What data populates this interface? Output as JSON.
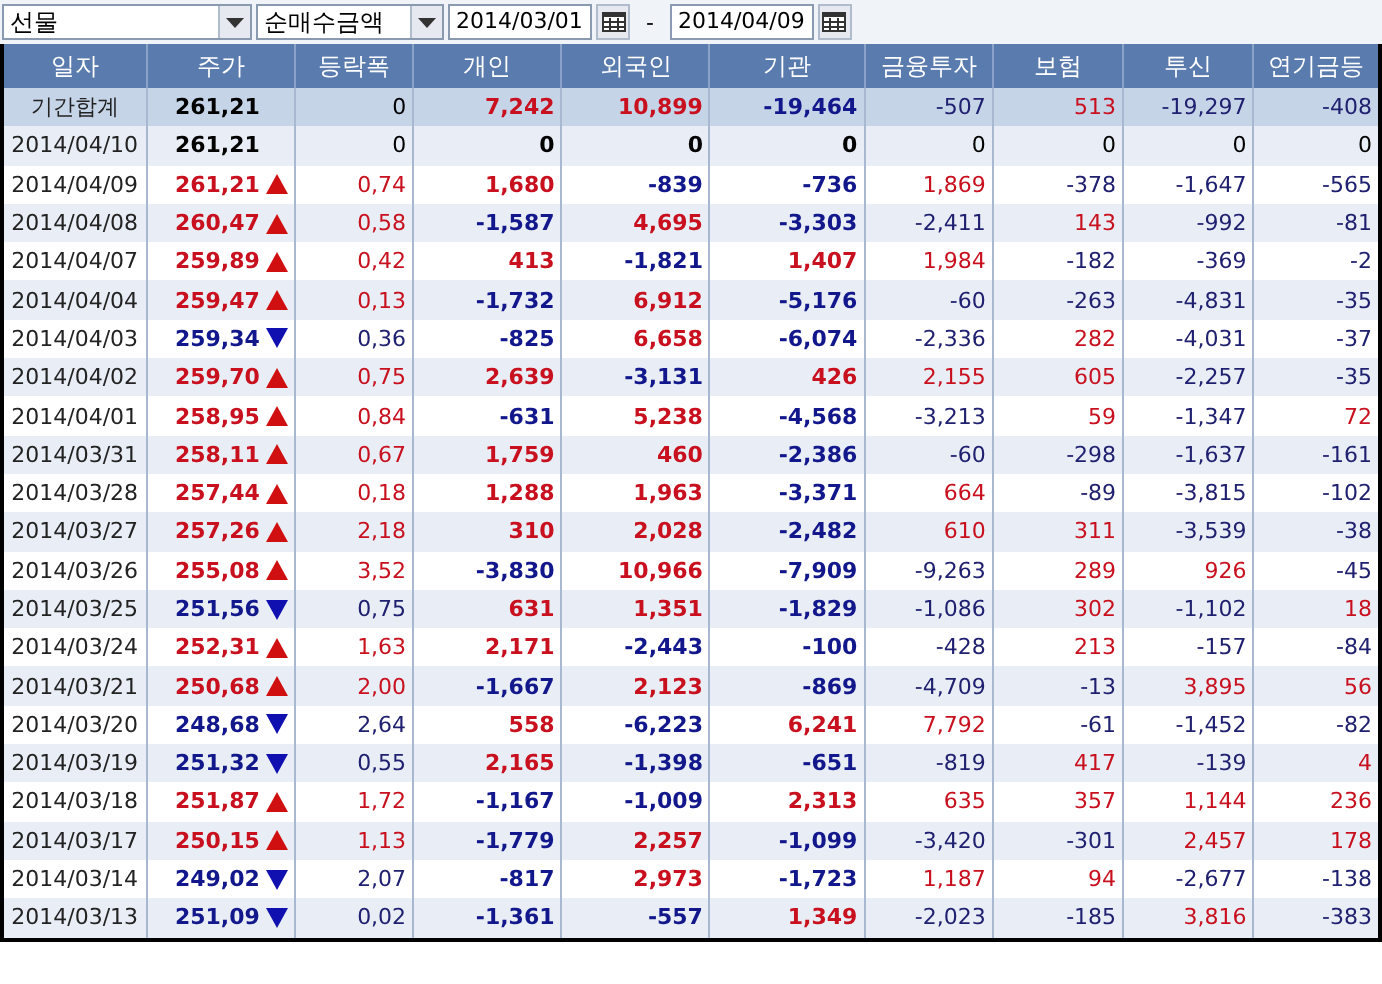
{
  "toolbar": {
    "market": "선물",
    "measure": "순매수금액",
    "date_from": "2014/03/01",
    "separator": "-",
    "date_to": "2014/04/09"
  },
  "columns": [
    "일자",
    "주가",
    "등락폭",
    "개인",
    "외국인",
    "기관",
    "금융투자",
    "보험",
    "투신",
    "연기금등"
  ],
  "rows": [
    {
      "kind": "total",
      "date": "기간합계",
      "price": "261,21",
      "up": false,
      "down": false,
      "change": "0",
      "values": [
        "7,242",
        "10,899",
        "-19,464",
        "-507",
        "513",
        "-19,297",
        "-408"
      ]
    },
    {
      "kind": "day",
      "date": "2014/04/10",
      "price": "261,21",
      "up": false,
      "down": false,
      "change": "0",
      "values": [
        "0",
        "0",
        "0",
        "0",
        "0",
        "0",
        "0"
      ]
    },
    {
      "kind": "day",
      "date": "2014/04/09",
      "price": "261,21",
      "up": true,
      "down": false,
      "change": "0,74",
      "values": [
        "1,680",
        "-839",
        "-736",
        "1,869",
        "-378",
        "-1,647",
        "-565"
      ]
    },
    {
      "kind": "day",
      "date": "2014/04/08",
      "price": "260,47",
      "up": true,
      "down": false,
      "change": "0,58",
      "values": [
        "-1,587",
        "4,695",
        "-3,303",
        "-2,411",
        "143",
        "-992",
        "-81"
      ]
    },
    {
      "kind": "day",
      "date": "2014/04/07",
      "price": "259,89",
      "up": true,
      "down": false,
      "change": "0,42",
      "values": [
        "413",
        "-1,821",
        "1,407",
        "1,984",
        "-182",
        "-369",
        "-2"
      ]
    },
    {
      "kind": "day",
      "date": "2014/04/04",
      "price": "259,47",
      "up": true,
      "down": false,
      "change": "0,13",
      "values": [
        "-1,732",
        "6,912",
        "-5,176",
        "-60",
        "-263",
        "-4,831",
        "-35"
      ]
    },
    {
      "kind": "day",
      "date": "2014/04/03",
      "price": "259,34",
      "up": false,
      "down": true,
      "change": "0,36",
      "values": [
        "-825",
        "6,658",
        "-6,074",
        "-2,336",
        "282",
        "-4,031",
        "-37"
      ]
    },
    {
      "kind": "day",
      "date": "2014/04/02",
      "price": "259,70",
      "up": true,
      "down": false,
      "change": "0,75",
      "values": [
        "2,639",
        "-3,131",
        "426",
        "2,155",
        "605",
        "-2,257",
        "-35"
      ]
    },
    {
      "kind": "day",
      "date": "2014/04/01",
      "price": "258,95",
      "up": true,
      "down": false,
      "change": "0,84",
      "values": [
        "-631",
        "5,238",
        "-4,568",
        "-3,213",
        "59",
        "-1,347",
        "72"
      ]
    },
    {
      "kind": "day",
      "date": "2014/03/31",
      "price": "258,11",
      "up": true,
      "down": false,
      "change": "0,67",
      "values": [
        "1,759",
        "460",
        "-2,386",
        "-60",
        "-298",
        "-1,637",
        "-161"
      ]
    },
    {
      "kind": "day",
      "date": "2014/03/28",
      "price": "257,44",
      "up": true,
      "down": false,
      "change": "0,18",
      "values": [
        "1,288",
        "1,963",
        "-3,371",
        "664",
        "-89",
        "-3,815",
        "-102"
      ]
    },
    {
      "kind": "day",
      "date": "2014/03/27",
      "price": "257,26",
      "up": true,
      "down": false,
      "change": "2,18",
      "values": [
        "310",
        "2,028",
        "-2,482",
        "610",
        "311",
        "-3,539",
        "-38"
      ]
    },
    {
      "kind": "day",
      "date": "2014/03/26",
      "price": "255,08",
      "up": true,
      "down": false,
      "change": "3,52",
      "values": [
        "-3,830",
        "10,966",
        "-7,909",
        "-9,263",
        "289",
        "926",
        "-45"
      ]
    },
    {
      "kind": "day",
      "date": "2014/03/25",
      "price": "251,56",
      "up": false,
      "down": true,
      "change": "0,75",
      "values": [
        "631",
        "1,351",
        "-1,829",
        "-1,086",
        "302",
        "-1,102",
        "18"
      ]
    },
    {
      "kind": "day",
      "date": "2014/03/24",
      "price": "252,31",
      "up": true,
      "down": false,
      "change": "1,63",
      "values": [
        "2,171",
        "-2,443",
        "-100",
        "-428",
        "213",
        "-157",
        "-84"
      ]
    },
    {
      "kind": "day",
      "date": "2014/03/21",
      "price": "250,68",
      "up": true,
      "down": false,
      "change": "2,00",
      "values": [
        "-1,667",
        "2,123",
        "-869",
        "-4,709",
        "-13",
        "3,895",
        "56"
      ]
    },
    {
      "kind": "day",
      "date": "2014/03/20",
      "price": "248,68",
      "up": false,
      "down": true,
      "change": "2,64",
      "values": [
        "558",
        "-6,223",
        "6,241",
        "7,792",
        "-61",
        "-1,452",
        "-82"
      ]
    },
    {
      "kind": "day",
      "date": "2014/03/19",
      "price": "251,32",
      "up": false,
      "down": true,
      "change": "0,55",
      "values": [
        "2,165",
        "-1,398",
        "-651",
        "-819",
        "417",
        "-139",
        "4"
      ]
    },
    {
      "kind": "day",
      "date": "2014/03/18",
      "price": "251,87",
      "up": true,
      "down": false,
      "change": "1,72",
      "values": [
        "-1,167",
        "-1,009",
        "2,313",
        "635",
        "357",
        "1,144",
        "236"
      ]
    },
    {
      "kind": "day",
      "date": "2014/03/17",
      "price": "250,15",
      "up": true,
      "down": false,
      "change": "1,13",
      "values": [
        "-1,779",
        "2,257",
        "-1,099",
        "-3,420",
        "-301",
        "2,457",
        "178"
      ]
    },
    {
      "kind": "day",
      "date": "2014/03/14",
      "price": "249,02",
      "up": false,
      "down": true,
      "change": "2,07",
      "values": [
        "-817",
        "2,973",
        "-1,723",
        "1,187",
        "94",
        "-2,677",
        "-138"
      ]
    },
    {
      "kind": "day",
      "date": "2014/03/13",
      "price": "251,09",
      "up": false,
      "down": true,
      "change": "0,02",
      "values": [
        "-1,361",
        "-557",
        "1,349",
        "-2,023",
        "-185",
        "3,816",
        "-383"
      ]
    }
  ]
}
